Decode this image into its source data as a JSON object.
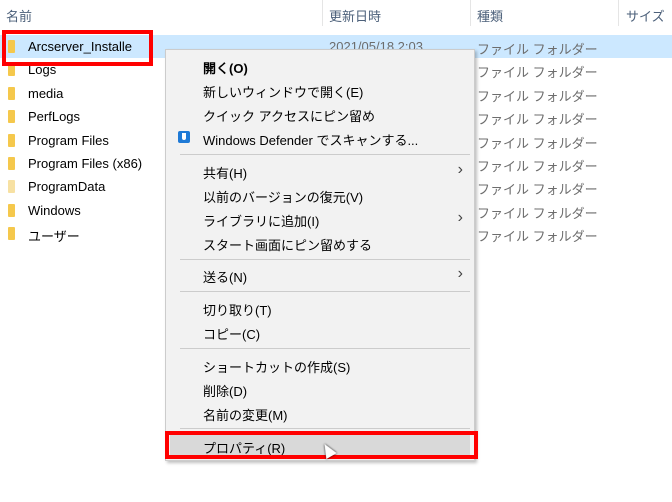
{
  "columns": {
    "name": "名前",
    "date": "更新日時",
    "type": "種類",
    "size": "サイズ"
  },
  "files": [
    {
      "name": "Arcserver_Installe",
      "date": "2021/05/18 2:03",
      "type": "ファイル フォルダー"
    },
    {
      "name": "Logs",
      "type": "ファイル フォルダー"
    },
    {
      "name": "media",
      "type": "ファイル フォルダー"
    },
    {
      "name": "PerfLogs",
      "type": "ファイル フォルダー"
    },
    {
      "name": "Program Files",
      "type": "ファイル フォルダー"
    },
    {
      "name": "Program Files (x86)",
      "type": "ファイル フォルダー"
    },
    {
      "name": "ProgramData",
      "type": "ファイル フォルダー"
    },
    {
      "name": "Windows",
      "type": "ファイル フォルダー"
    },
    {
      "name": "ユーザー",
      "type": "ファイル フォルダー"
    }
  ],
  "menu": {
    "open": "開く(O)",
    "open_new": "新しいウィンドウで開く(E)",
    "pin_quick": "クイック アクセスにピン留め",
    "defender": "Windows Defender でスキャンする...",
    "share": "共有(H)",
    "restore": "以前のバージョンの復元(V)",
    "library": "ライブラリに追加(I)",
    "pin_start": "スタート画面にピン留めする",
    "send": "送る(N)",
    "cut": "切り取り(T)",
    "copy": "コピー(C)",
    "shortcut": "ショートカットの作成(S)",
    "delete": "削除(D)",
    "rename": "名前の変更(M)",
    "properties": "プロパティ(R)"
  },
  "colors": {
    "highlight": "#f00",
    "selection": "#cce8ff"
  }
}
